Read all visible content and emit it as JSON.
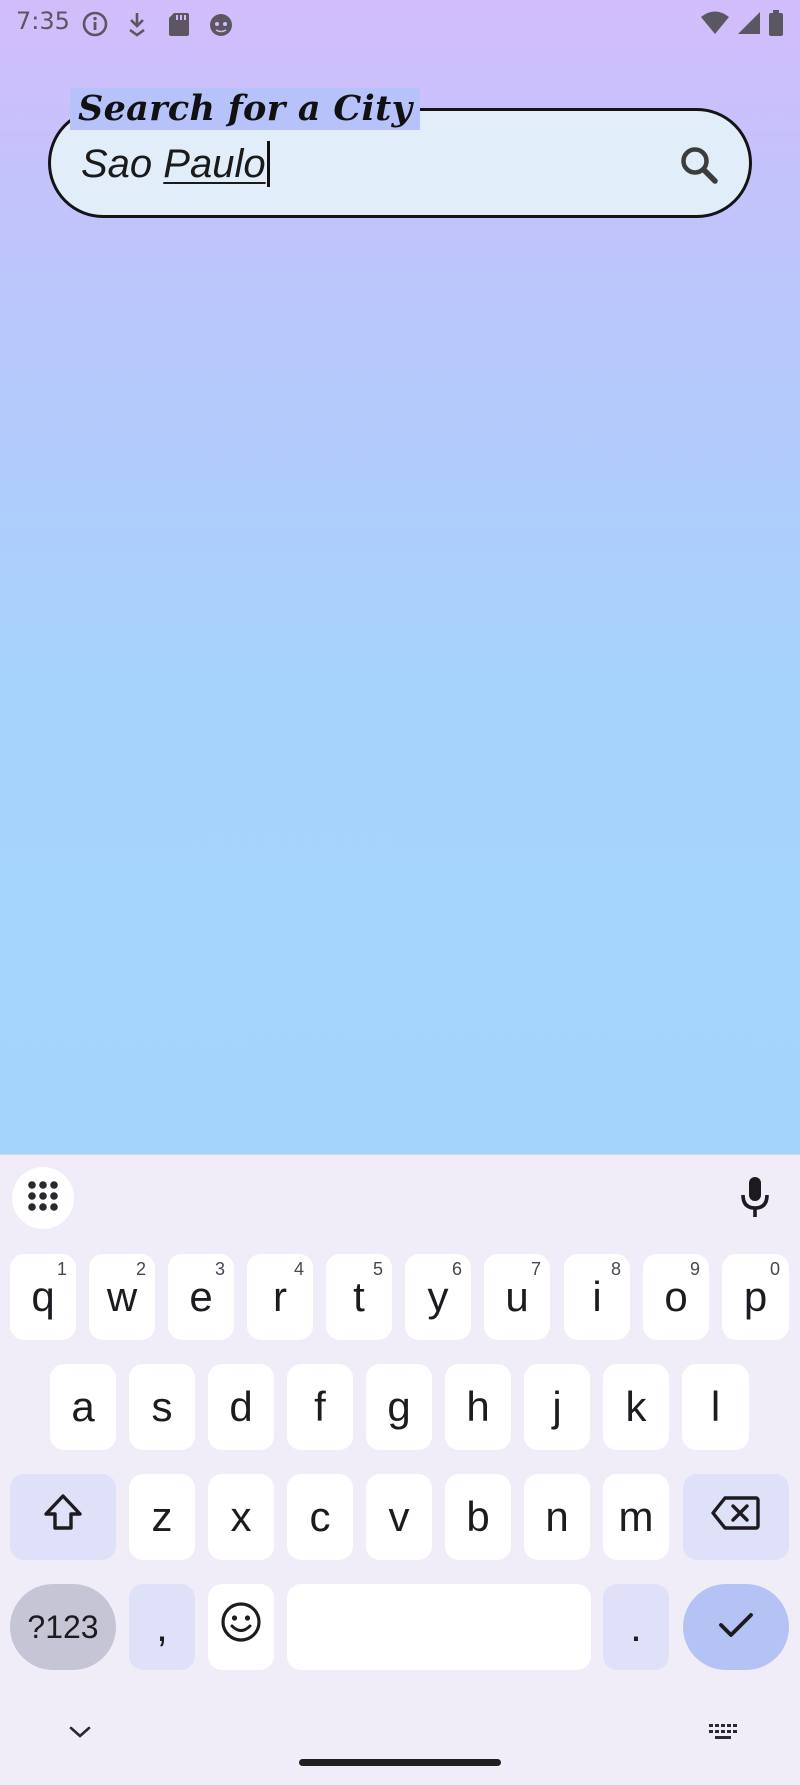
{
  "status_bar": {
    "time": "7:35",
    "left_icons": [
      "info-icon",
      "download-icon",
      "sd-card-icon",
      "android-face-icon"
    ],
    "right_icons": [
      "wifi-icon",
      "signal-icon",
      "battery-icon"
    ]
  },
  "search": {
    "label": "Search for a City",
    "value_plain": "Sao ",
    "value_underlined": "Paulo",
    "button_icon": "search-icon"
  },
  "keyboard": {
    "toolbar": {
      "left_icon": "apps-grid-icon",
      "right_icon": "mic-icon"
    },
    "row1": [
      {
        "k": "q",
        "h": "1"
      },
      {
        "k": "w",
        "h": "2"
      },
      {
        "k": "e",
        "h": "3"
      },
      {
        "k": "r",
        "h": "4"
      },
      {
        "k": "t",
        "h": "5"
      },
      {
        "k": "y",
        "h": "6"
      },
      {
        "k": "u",
        "h": "7"
      },
      {
        "k": "i",
        "h": "8"
      },
      {
        "k": "o",
        "h": "9"
      },
      {
        "k": "p",
        "h": "0"
      }
    ],
    "row2": [
      "a",
      "s",
      "d",
      "f",
      "g",
      "h",
      "j",
      "k",
      "l"
    ],
    "row3": [
      "z",
      "x",
      "c",
      "v",
      "b",
      "n",
      "m"
    ],
    "row4": {
      "symbols": "?123",
      "comma": ",",
      "period": "."
    },
    "bottom": {
      "hide_icon": "chevron-down-icon",
      "switch_icon": "keyboard-icon"
    }
  }
}
